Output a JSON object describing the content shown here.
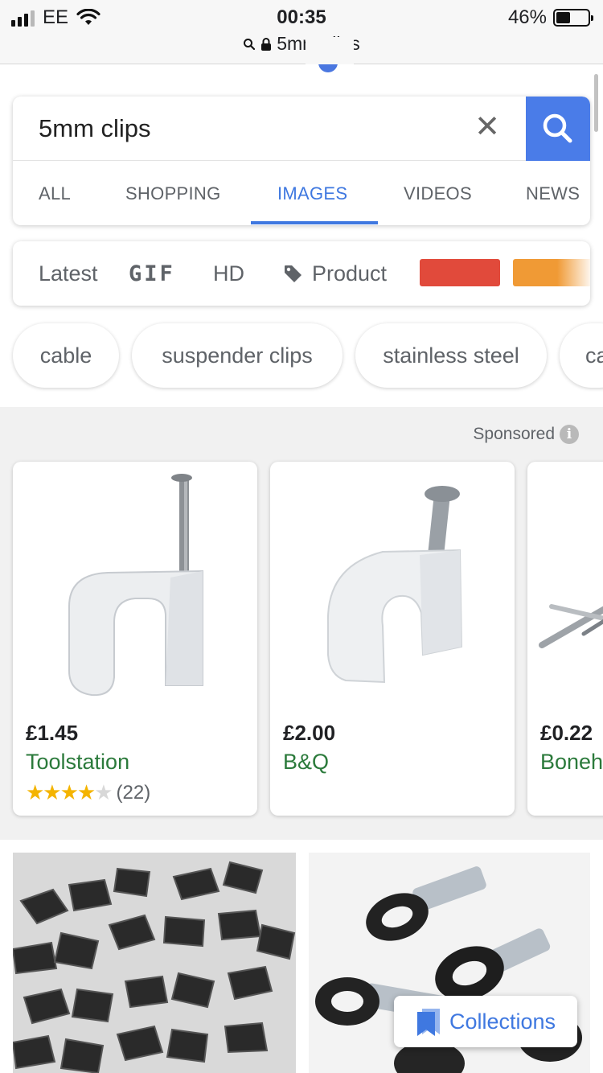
{
  "status_bar": {
    "carrier": "EE",
    "time": "00:35",
    "battery": "46%",
    "battery_level": 0.46,
    "url": "5mm clips"
  },
  "search": {
    "query": "5mm clips",
    "tabs": [
      {
        "label": "ALL"
      },
      {
        "label": "SHOPPING"
      },
      {
        "label": "IMAGES",
        "active": true
      },
      {
        "label": "VIDEOS"
      },
      {
        "label": "NEWS"
      }
    ]
  },
  "filters": {
    "items": [
      "Latest",
      "GIF",
      "HD",
      "Product"
    ],
    "color_swatches": [
      "#e14a3b",
      "#f09a35"
    ]
  },
  "chips": [
    "cable",
    "suspender clips",
    "stainless steel",
    "ca"
  ],
  "sponsored": {
    "label": "Sponsored",
    "products": [
      {
        "price": "£1.45",
        "merchant": "Toolstation",
        "rating": 4.5,
        "rating_count": "(22)"
      },
      {
        "price": "£2.00",
        "merchant": "B&Q"
      },
      {
        "price": "£0.22",
        "merchant": "Boneh"
      }
    ]
  },
  "collections_button": {
    "label": "Collections"
  },
  "colors": {
    "accent_blue": "#3f78e0",
    "merchant_green": "#2b7a3b",
    "star_yellow": "#f4b400"
  }
}
